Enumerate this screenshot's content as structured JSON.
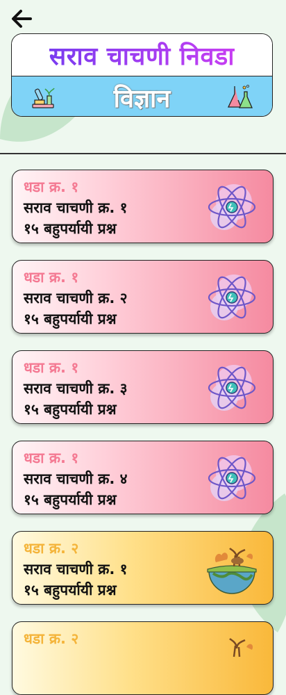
{
  "header": {
    "back_icon": "arrow-left-icon",
    "title": "सराव चाचणी निवडा",
    "subject": "विज्ञान",
    "left_icon": "microscope-lab-icon",
    "right_icon": "chemistry-flask-icon"
  },
  "tests": [
    {
      "lesson": "धडा क्र. १",
      "test": "सराव चाचणी क्र. १",
      "questions": "१५ बहुपर्यायी प्रश्न",
      "theme": "pink",
      "icon": "atom-icon"
    },
    {
      "lesson": "धडा क्र. १",
      "test": "सराव चाचणी क्र. २",
      "questions": "१५ बहुपर्यायी प्रश्न",
      "theme": "pink",
      "icon": "atom-icon"
    },
    {
      "lesson": "धडा क्र. १",
      "test": "सराव चाचणी क्र. ३",
      "questions": "१५ बहुपर्यायी प्रश्न",
      "theme": "pink",
      "icon": "atom-icon"
    },
    {
      "lesson": "धडा क्र. १",
      "test": "सराव चाचणी क्र. ४",
      "questions": "१५ बहुपर्यायी प्रश्न",
      "theme": "pink",
      "icon": "atom-icon"
    },
    {
      "lesson": "धडा क्र. २",
      "test": "सराव चाचणी क्र. १",
      "questions": "१५ बहुपर्यायी प्रश्न",
      "theme": "orange",
      "icon": "earth-ecosystem-icon"
    },
    {
      "lesson": "धडा क्र. २",
      "test": "",
      "questions": "",
      "theme": "orange",
      "icon": "earth-ecosystem-icon"
    }
  ],
  "colors": {
    "title_gradient_start": "#7a3cf0",
    "title_gradient_end": "#c73ef2",
    "subject_bar": "#7fd3f7",
    "pink_lesson": "#f47a93",
    "orange_lesson": "#f4b43a"
  }
}
